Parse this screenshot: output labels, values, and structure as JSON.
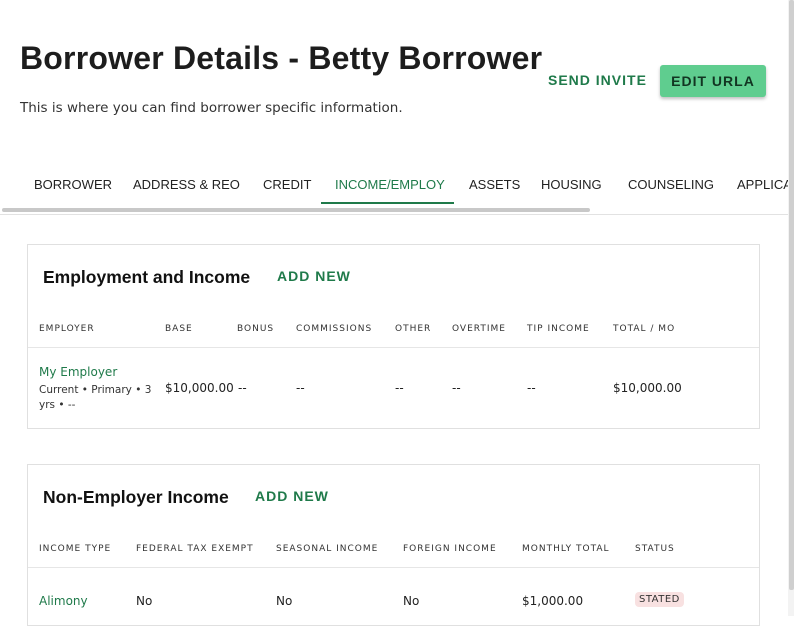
{
  "header": {
    "title": "Borrower Details - Betty Borrower",
    "subtitle": "This is where you can find borrower specific information.",
    "send_invite_label": "SEND INVITE",
    "edit_urla_label": "EDIT URLA"
  },
  "tabs": [
    {
      "label": "BORROWER"
    },
    {
      "label": "ADDRESS & REO"
    },
    {
      "label": "CREDIT"
    },
    {
      "label": "INCOME/EMPLOY",
      "active": true
    },
    {
      "label": "ASSETS"
    },
    {
      "label": "HOUSING"
    },
    {
      "label": "COUNSELING"
    },
    {
      "label": "APPLICAT"
    }
  ],
  "employment": {
    "title": "Employment and Income",
    "add_new_label": "ADD NEW",
    "columns": [
      "EMPLOYER",
      "BASE",
      "BONUS",
      "COMMISSIONS",
      "OTHER",
      "OVERTIME",
      "TIP INCOME",
      "TOTAL / MO"
    ],
    "rows": [
      {
        "employer": "My Employer",
        "meta": "Current • Primary • 3 yrs • --",
        "base": "$10,000.00",
        "bonus": "--",
        "commissions": "--",
        "other": "--",
        "overtime": "--",
        "tip_income": "--",
        "total": "$10,000.00"
      }
    ]
  },
  "non_employer": {
    "title": "Non-Employer Income",
    "add_new_label": "ADD NEW",
    "columns": [
      "INCOME TYPE",
      "FEDERAL TAX EXEMPT",
      "SEASONAL INCOME",
      "FOREIGN INCOME",
      "MONTHLY TOTAL",
      "STATUS"
    ],
    "rows": [
      {
        "income_type": "Alimony",
        "federal_tax_exempt": "No",
        "seasonal_income": "No",
        "foreign_income": "No",
        "monthly_total": "$1,000.00",
        "status": "STATED"
      }
    ]
  },
  "colors": {
    "accent": "#1f7a4a",
    "primary_button": "#5fcd8f",
    "status_badge_bg": "#f8e1e1"
  }
}
